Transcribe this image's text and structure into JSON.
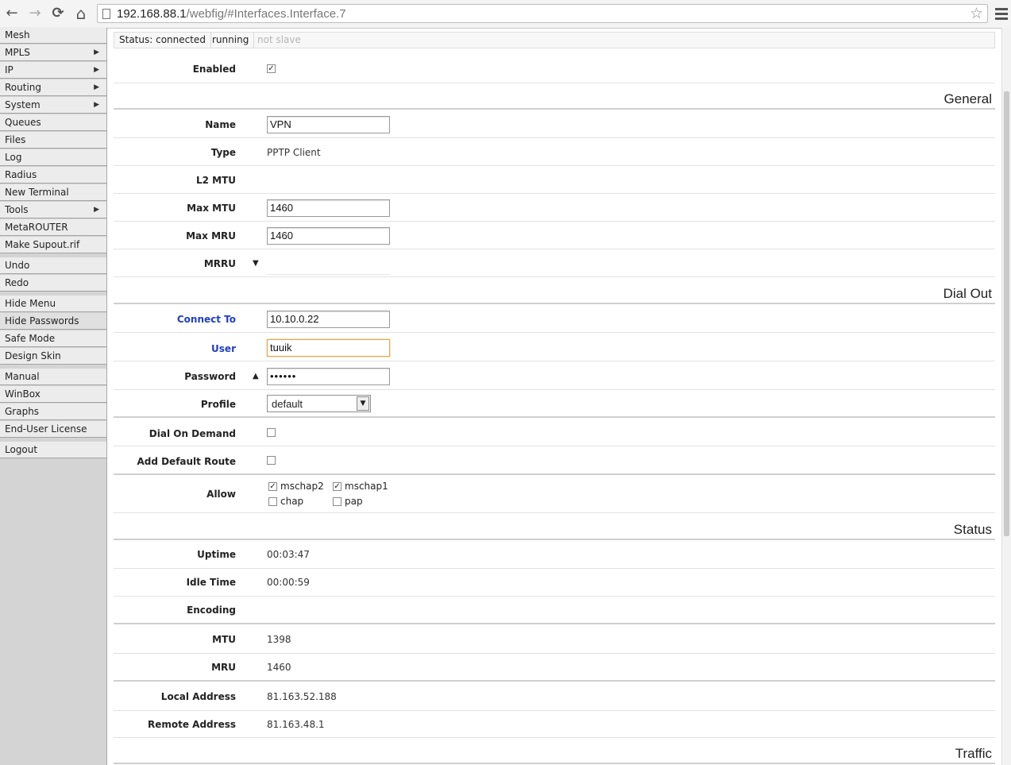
{
  "browser": {
    "back_icon": "←",
    "forward_icon": "→",
    "reload_icon": "⟳",
    "home_icon": "⌂",
    "url_host": "192.168.88.1",
    "url_path": "/webfig/#Interfaces.Interface.7",
    "star_icon": "☆"
  },
  "sidebar": {
    "items": [
      {
        "label": "Mesh"
      },
      {
        "label": "MPLS",
        "arrow": "▶"
      },
      {
        "label": "IP",
        "arrow": "▶"
      },
      {
        "label": "Routing",
        "arrow": "▶"
      },
      {
        "label": "System",
        "arrow": "▶"
      },
      {
        "label": "Queues"
      },
      {
        "label": "Files"
      },
      {
        "label": "Log"
      },
      {
        "label": "Radius"
      },
      {
        "label": "New Terminal"
      },
      {
        "label": "Tools",
        "arrow": "▶"
      },
      {
        "label": "MetaROUTER"
      },
      {
        "label": "Make Supout.rif"
      },
      {
        "label": "Undo"
      },
      {
        "label": "Redo"
      },
      {
        "label": "Hide Menu"
      },
      {
        "label": "Hide Passwords"
      },
      {
        "label": "Safe Mode"
      },
      {
        "label": "Design Skin"
      },
      {
        "label": "Manual"
      },
      {
        "label": "WinBox"
      },
      {
        "label": "Graphs"
      },
      {
        "label": "End-User License"
      },
      {
        "label": "Logout"
      }
    ]
  },
  "status": {
    "connected": "Status: connected",
    "running": "running",
    "slave": "not slave"
  },
  "form": {
    "enabled_label": "Enabled",
    "enabled_check": "✓",
    "general_title": "General",
    "name_label": "Name",
    "name_value": "VPN",
    "type_label": "Type",
    "type_value": "PPTP Client",
    "l2mtu_label": "L2 MTU",
    "maxmtu_label": "Max MTU",
    "maxmtu_value": "1460",
    "maxmru_label": "Max MRU",
    "maxmru_value": "1460",
    "mrru_label": "MRRU",
    "mrru_toggle": "▼",
    "dialout_title": "Dial Out",
    "connectto_label": "Connect To",
    "connectto_value": "10.10.0.22",
    "user_label": "User",
    "user_value": "tuuik",
    "password_label": "Password",
    "password_toggle": "▲",
    "password_value": "••••••",
    "profile_label": "Profile",
    "profile_value": "default",
    "profile_dropdown": "▼",
    "dialondemand_label": "Dial On Demand",
    "adddefault_label": "Add Default Route",
    "allow_label": "Allow",
    "allow_options": [
      {
        "label": "mschap2",
        "check": "✓"
      },
      {
        "label": "mschap1",
        "check": "✓"
      },
      {
        "label": "chap",
        "check": ""
      },
      {
        "label": "pap",
        "check": ""
      }
    ],
    "status_title": "Status",
    "uptime_label": "Uptime",
    "uptime_value": "00:03:47",
    "idle_label": "Idle Time",
    "idle_value": "00:00:59",
    "encoding_label": "Encoding",
    "mtu_label": "MTU",
    "mtu_value": "1398",
    "mru_label": "MRU",
    "mru_value": "1460",
    "local_label": "Local Address",
    "local_value": "81.163.52.188",
    "remote_label": "Remote Address",
    "remote_value": "81.163.48.1",
    "traffic_title": "Traffic"
  }
}
